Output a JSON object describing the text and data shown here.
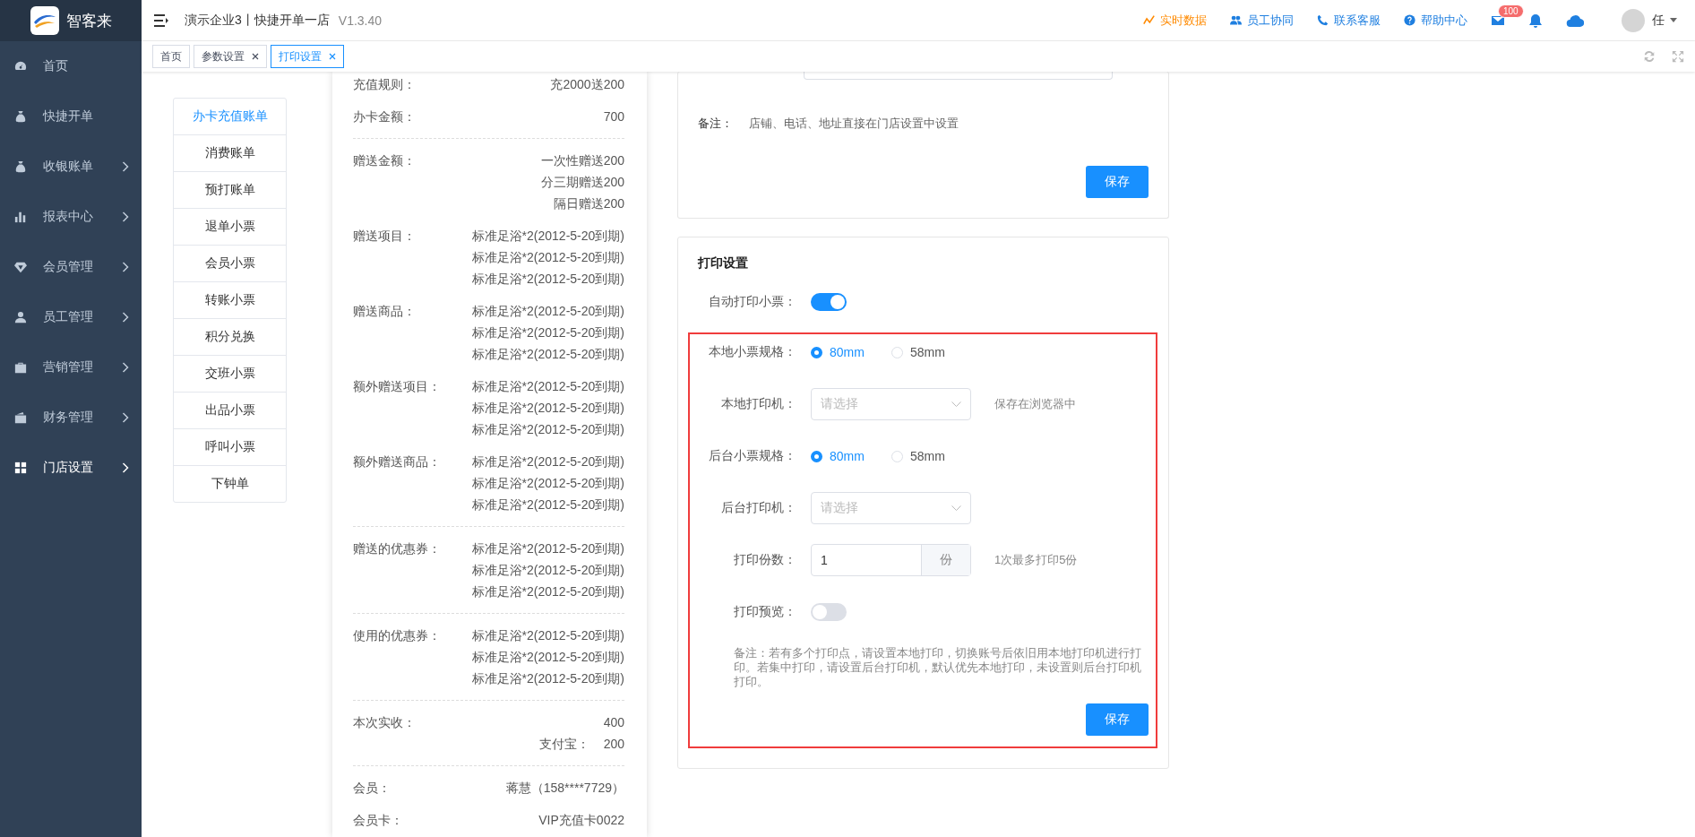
{
  "app": {
    "logo_text": "智客来"
  },
  "header": {
    "company": "演示企业3丨快捷开单一店",
    "version": "V1.3.40",
    "links": [
      {
        "label": "实时数据",
        "highlight": true
      },
      {
        "label": "员工协同",
        "highlight": false
      },
      {
        "label": "联系客服",
        "highlight": false
      },
      {
        "label": "帮助中心",
        "highlight": false
      }
    ],
    "mail_badge": "100",
    "user": "任"
  },
  "sidebar": {
    "items": [
      {
        "label": "首页",
        "has_arrow": false,
        "selected": false
      },
      {
        "label": "快捷开单",
        "has_arrow": false,
        "selected": false
      },
      {
        "label": "收银账单",
        "has_arrow": true,
        "selected": false
      },
      {
        "label": "报表中心",
        "has_arrow": true,
        "selected": false
      },
      {
        "label": "会员管理",
        "has_arrow": true,
        "selected": false
      },
      {
        "label": "员工管理",
        "has_arrow": true,
        "selected": false
      },
      {
        "label": "营销管理",
        "has_arrow": true,
        "selected": false
      },
      {
        "label": "财务管理",
        "has_arrow": true,
        "selected": false
      },
      {
        "label": "门店设置",
        "has_arrow": true,
        "selected": true
      }
    ]
  },
  "tabs": [
    {
      "label": "首页",
      "closable": false,
      "selected": false
    },
    {
      "label": "参数设置",
      "closable": true,
      "selected": false
    },
    {
      "label": "打印设置",
      "closable": true,
      "selected": true
    }
  ],
  "ticket_types": [
    {
      "label": "办卡充值账单",
      "selected": true
    },
    {
      "label": "消费账单",
      "selected": false
    },
    {
      "label": "预打账单",
      "selected": false
    },
    {
      "label": "退单小票",
      "selected": false
    },
    {
      "label": "会员小票",
      "selected": false
    },
    {
      "label": "转账小票",
      "selected": false
    },
    {
      "label": "积分兑换",
      "selected": false
    },
    {
      "label": "交班小票",
      "selected": false
    },
    {
      "label": "出品小票",
      "selected": false
    },
    {
      "label": "呼叫小票",
      "selected": false
    },
    {
      "label": "下钟单",
      "selected": false
    }
  ],
  "receipt": {
    "sections": [
      {
        "rows": [
          {
            "kind": "pair",
            "label": "充值规则：",
            "values": [
              "充2000送200"
            ]
          },
          {
            "kind": "pair",
            "label": "办卡金额：",
            "values": [
              "700"
            ]
          }
        ]
      },
      {
        "rows": [
          {
            "kind": "pair",
            "label": "赠送金额：",
            "values": [
              "一次性赠送200",
              "分三期赠送200",
              "隔日赠送200"
            ]
          },
          {
            "kind": "pair",
            "label": "赠送项目：",
            "values": [
              "标准足浴*2(2012-5-20到期)",
              "标准足浴*2(2012-5-20到期)",
              "标准足浴*2(2012-5-20到期)"
            ]
          },
          {
            "kind": "pair",
            "label": "赠送商品：",
            "values": [
              "标准足浴*2(2012-5-20到期)",
              "标准足浴*2(2012-5-20到期)",
              "标准足浴*2(2012-5-20到期)"
            ]
          },
          {
            "kind": "pair",
            "label": "额外赠送项目：",
            "values": [
              "标准足浴*2(2012-5-20到期)",
              "标准足浴*2(2012-5-20到期)",
              "标准足浴*2(2012-5-20到期)"
            ]
          },
          {
            "kind": "pair",
            "label": "额外赠送商品：",
            "values": [
              "标准足浴*2(2012-5-20到期)",
              "标准足浴*2(2012-5-20到期)",
              "标准足浴*2(2012-5-20到期)"
            ]
          }
        ]
      },
      {
        "rows": [
          {
            "kind": "pair",
            "label": "赠送的优惠券：",
            "values": [
              "标准足浴*2(2012-5-20到期)",
              "标准足浴*2(2012-5-20到期)",
              "标准足浴*2(2012-5-20到期)"
            ]
          }
        ]
      },
      {
        "rows": [
          {
            "kind": "pair",
            "label": "使用的优惠券：",
            "values": [
              "标准足浴*2(2012-5-20到期)",
              "标准足浴*2(2012-5-20到期)",
              "标准足浴*2(2012-5-20到期)"
            ]
          }
        ]
      },
      {
        "rows": [
          {
            "kind": "pair",
            "label": "本次实收：",
            "values": [
              "400"
            ]
          },
          {
            "kind": "sub",
            "label": "支付宝：",
            "values": [
              "200"
            ]
          }
        ]
      },
      {
        "rows": [
          {
            "kind": "pair",
            "label": "会员：",
            "values": [
              "蒋慧（158****7729）"
            ]
          },
          {
            "kind": "pair",
            "label": "会员卡：",
            "values": [
              "VIP充值卡0022"
            ]
          }
        ]
      }
    ]
  },
  "store_card": {
    "note_label": "备注：",
    "note": "店铺、电话、地址直接在门店设置中设置",
    "save": "保存"
  },
  "print_card": {
    "title": "打印设置",
    "auto_print": {
      "label": "自动打印小票：",
      "on": true
    },
    "rows": [
      {
        "kind": "radio",
        "label": "本地小票规格：",
        "options": [
          {
            "label": "80mm",
            "selected": true
          },
          {
            "label": "58mm",
            "selected": false
          }
        ]
      },
      {
        "kind": "select",
        "label": "本地打印机：",
        "placeholder": "请选择",
        "hint": "保存在浏览器中"
      },
      {
        "kind": "radio",
        "label": "后台小票规格：",
        "options": [
          {
            "label": "80mm",
            "selected": true
          },
          {
            "label": "58mm",
            "selected": false
          }
        ]
      },
      {
        "kind": "select",
        "label": "后台打印机：",
        "placeholder": "请选择"
      },
      {
        "kind": "number",
        "label": "打印份数：",
        "value": "1",
        "unit": "份",
        "hint": "1次最多打印5份"
      },
      {
        "kind": "switch",
        "label": "打印预览：",
        "on": false
      }
    ],
    "note": "备注：若有多个打印点，请设置本地打印，切换账号后依旧用本地打印机进行打印。若集中打印，请设置后台打印机，默认优先本地打印，未设置则后台打印机打印。",
    "save": "保存"
  }
}
